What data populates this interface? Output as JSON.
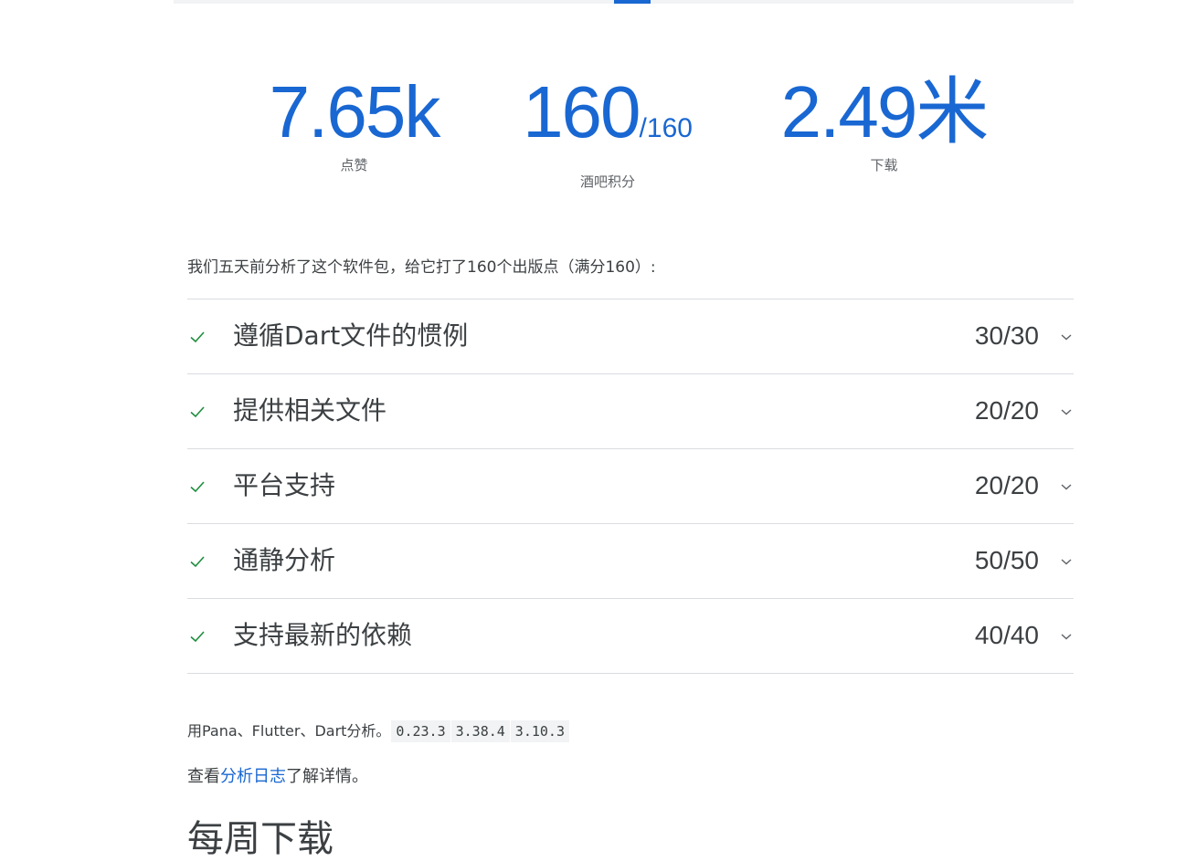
{
  "stats": {
    "likes": {
      "value": "7.65k",
      "label": "点赞"
    },
    "points": {
      "value": "160",
      "suffix": "/160",
      "label": "酒吧积分"
    },
    "downloads": {
      "value": "2.49米",
      "label": "下载"
    }
  },
  "summary": "我们五天前分析了这个软件包，给它打了160个出版点（满分160）:",
  "sections": [
    {
      "title": "遵循Dart文件的惯例",
      "score": "30/30",
      "icon": "check-icon"
    },
    {
      "title": "提供相关文件",
      "score": "20/20",
      "icon": "check-icon"
    },
    {
      "title": "平台支持",
      "score": "20/20",
      "icon": "check-icon"
    },
    {
      "title": "通静分析",
      "score": "50/50",
      "icon": "check-icon"
    },
    {
      "title": "支持最新的依赖",
      "score": "40/40",
      "icon": "check-icon"
    }
  ],
  "analyzed_with": {
    "text": "用Pana、Flutter、Dart分析。",
    "versions": [
      "0.23.3",
      "3.38.4",
      "3.10.3"
    ]
  },
  "log_line": {
    "prefix": "查看",
    "link": "分析日志",
    "suffix": "了解详情。"
  },
  "next_heading": "每周下载",
  "colors": {
    "accent": "#1967d2",
    "check": "#1e8e3e",
    "divider": "#dadce0"
  }
}
